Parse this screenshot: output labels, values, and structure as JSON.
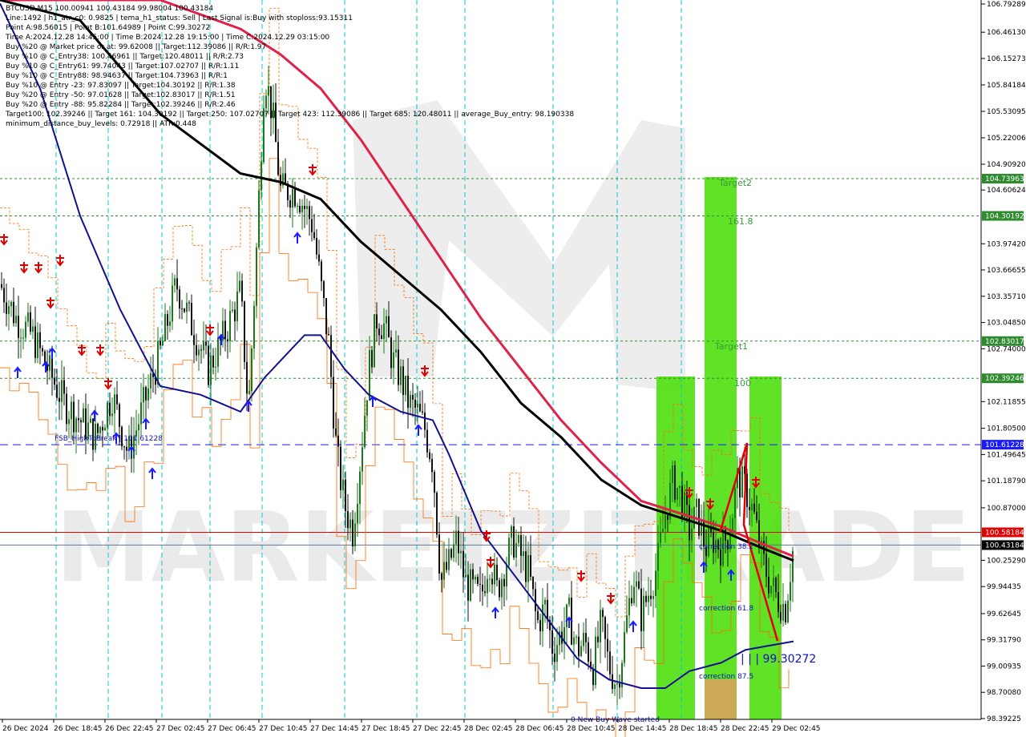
{
  "info_lines": [
    "BTCUSD,M15  100.00941 100.43184 99.98004 100.43184",
    "Line:1492  |  h1_atr_c0: 0.9825  |  tema_h1_status: Sell  |  Last Signal is:Buy with stoploss:93.15311",
    "Point A:98.56015  |  Point B:101.64989  |  Point C:99.30272",
    "Time A:2024.12.28 14:45:00  |  Time B:2024.12.28 19:15:00  |  Time C:2024.12.29 03:15:00",
    "Buy %20 @ Market price or at: 99.62008  ||  Target:112.39086  ||  R/R:1.97",
    "Buy %10 @ C_Entry38: 100.46961  ||  Target:120.48011  ||  R/R:2.73",
    "Buy %10 @ C_Entry61: 99.74043  ||  Target:107.02707  ||  R/R:1.11",
    "Buy %10 @ C_Entry88: 98.94637  ||  Target:104.73963  ||  R/R:1",
    "Buy %10 @ Entry -23: 97.83097  ||  Target:104.30192  ||  R/R:1.38",
    "Buy %20 @ Entry -50: 97.01628  ||  Target:102.83017  ||  R/R:1.51",
    "Buy %20 @ Entry -88: 95.82284  ||  Target:102.39246  ||  R/R:2.46",
    "Target100: 102.39246  ||  Target 161: 104.30192  ||  Target 250: 107.02707  ||  Target 423: 112.39086  ||  Target 685: 120.48011  ||  average_Buy_entry: 98.190338",
    "minimum_distance_buy_levels: 0.72918  ||  ATR:0.448"
  ],
  "annotations": {
    "target2": "Target2",
    "fib161": "161.8",
    "target1": "Target1",
    "fib100": "100",
    "corr38": "correction 38.2",
    "corr61": "correction 61.8",
    "corr87": "correction 87.5",
    "fsb": "FSB_HighToBreak | 101.61228",
    "point_c": "| | | 99.30272",
    "wave": "0 New Buy Wave started",
    "watermark": "MARKETZITRADE"
  },
  "price_tags": [
    {
      "label": "104.73963",
      "bg": "#2e8b2e"
    },
    {
      "label": "104.30192",
      "bg": "#2e8b2e"
    },
    {
      "label": "102.83017",
      "bg": "#2e8b2e"
    },
    {
      "label": "102.39246",
      "bg": "#2e8b2e"
    },
    {
      "label": "101.61228",
      "bg": "#1a1aff"
    },
    {
      "label": "100.58184",
      "bg": "#e00000"
    },
    {
      "label": "100.43184",
      "bg": "#000000"
    }
  ],
  "colors": {
    "sma_black": "#000000",
    "ema_red": "#e0224a",
    "ma_blue": "#101090",
    "up_candle": "#1a7a1a",
    "down_candle": "#111111",
    "green_zone": "#44dd00",
    "target_zone": "#ccaa55",
    "dashed_blue": "#1a1aff",
    "stop_red": "#e00000",
    "vgrid": "#00cccc"
  },
  "chart_data": {
    "type": "candlestick",
    "symbol": "BTCUSD,M15",
    "ylim": [
      98.39225,
      106.79289
    ],
    "y_ticks": [
      "106.79289",
      "106.46130",
      "106.15273",
      "105.84184",
      "105.53095",
      "105.22006",
      "104.90920",
      "104.60624",
      "103.97420",
      "103.66655",
      "103.35710",
      "103.04850",
      "102.74000",
      "102.11855",
      "101.80500",
      "101.49645",
      "101.18790",
      "100.87000",
      "100.25290",
      "99.94435",
      "99.62645",
      "99.31790",
      "99.00935",
      "98.70080",
      "98.39225"
    ],
    "x_ticks": [
      "26 Dec 2024",
      "26 Dec 18:45",
      "26 Dec 22:45",
      "27 Dec 02:45",
      "27 Dec 06:45",
      "27 Dec 10:45",
      "27 Dec 14:45",
      "27 Dec 18:45",
      "27 Dec 22:45",
      "28 Dec 02:45",
      "28 Dec 06:45",
      "28 Dec 10:45",
      "28 Dec 14:45",
      "28 Dec 18:45",
      "28 Dec 22:45",
      "29 Dec 02:45"
    ],
    "close_anchors": [
      [
        0,
        103.5
      ],
      [
        20,
        103.1
      ],
      [
        40,
        102.9
      ],
      [
        60,
        102.5
      ],
      [
        80,
        102.1
      ],
      [
        100,
        101.9
      ],
      [
        120,
        101.7
      ],
      [
        140,
        102.2
      ],
      [
        160,
        101.5
      ],
      [
        180,
        102.1
      ],
      [
        200,
        102.7
      ],
      [
        220,
        103.5
      ],
      [
        240,
        103.0
      ],
      [
        260,
        102.5
      ],
      [
        280,
        102.9
      ],
      [
        300,
        103.4
      ],
      [
        310,
        102.0
      ],
      [
        320,
        103.9
      ],
      [
        330,
        106.0
      ],
      [
        340,
        105.5
      ],
      [
        350,
        104.6
      ],
      [
        370,
        104.6
      ],
      [
        380,
        104.4
      ],
      [
        390,
        104.2
      ],
      [
        400,
        103.5
      ],
      [
        410,
        102.8
      ],
      [
        420,
        101.5
      ],
      [
        430,
        100.9
      ],
      [
        440,
        100.6
      ],
      [
        450,
        101.5
      ],
      [
        460,
        102.5
      ],
      [
        470,
        103.1
      ],
      [
        480,
        103.0
      ],
      [
        490,
        102.6
      ],
      [
        500,
        102.4
      ],
      [
        510,
        102.1
      ],
      [
        520,
        102.0
      ],
      [
        530,
        101.8
      ],
      [
        540,
        101.4
      ],
      [
        550,
        100.0
      ],
      [
        560,
        100.2
      ],
      [
        570,
        100.5
      ],
      [
        580,
        100.0
      ],
      [
        590,
        99.9
      ],
      [
        600,
        99.8
      ],
      [
        610,
        100.3
      ],
      [
        620,
        99.9
      ],
      [
        630,
        100.2
      ],
      [
        640,
        100.5
      ],
      [
        650,
        100.3
      ],
      [
        660,
        100.1
      ],
      [
        670,
        99.5
      ],
      [
        680,
        99.7
      ],
      [
        690,
        99.2
      ],
      [
        700,
        99.4
      ],
      [
        710,
        99.6
      ],
      [
        720,
        99.2
      ],
      [
        730,
        99.3
      ],
      [
        740,
        99.0
      ],
      [
        750,
        99.5
      ],
      [
        760,
        99.0
      ],
      [
        770,
        98.8
      ],
      [
        780,
        99.4
      ],
      [
        790,
        100.1
      ],
      [
        800,
        99.6
      ],
      [
        810,
        99.9
      ],
      [
        820,
        100.2
      ],
      [
        830,
        100.8
      ],
      [
        840,
        101.2
      ],
      [
        850,
        101.0
      ],
      [
        860,
        100.6
      ],
      [
        870,
        100.8
      ],
      [
        880,
        100.4
      ],
      [
        890,
        100.5
      ],
      [
        900,
        100.4
      ],
      [
        910,
        100.6
      ],
      [
        920,
        101.2
      ],
      [
        930,
        101.1
      ],
      [
        940,
        100.8
      ],
      [
        950,
        100.3
      ],
      [
        960,
        100.0
      ],
      [
        970,
        99.8
      ],
      [
        980,
        99.7
      ],
      [
        990,
        100.43
      ]
    ],
    "series": [
      {
        "name": "",
        "type": "sma",
        "points": [
          [
            0,
            107.2
          ],
          [
            100,
            106.6
          ],
          [
            200,
            105.5
          ],
          [
            300,
            104.8
          ],
          [
            350,
            104.7
          ],
          [
            400,
            104.5
          ],
          [
            450,
            104.0
          ],
          [
            500,
            103.6
          ],
          [
            550,
            103.2
          ],
          [
            600,
            102.7
          ],
          [
            650,
            102.1
          ],
          [
            700,
            101.7
          ],
          [
            750,
            101.2
          ],
          [
            800,
            100.9
          ],
          [
            850,
            100.75
          ],
          [
            900,
            100.6
          ],
          [
            950,
            100.4
          ],
          [
            990,
            100.25
          ]
        ]
      },
      {
        "name": "",
        "type": "ema",
        "points": [
          [
            0,
            108.0
          ],
          [
            100,
            107.8
          ],
          [
            200,
            107.5
          ],
          [
            300,
            106.5
          ],
          [
            350,
            106.2
          ],
          [
            400,
            105.8
          ],
          [
            450,
            105.2
          ],
          [
            500,
            104.5
          ],
          [
            550,
            103.8
          ],
          [
            600,
            103.1
          ],
          [
            650,
            102.5
          ],
          [
            700,
            101.9
          ],
          [
            750,
            101.4
          ],
          [
            800,
            100.95
          ],
          [
            850,
            100.8
          ],
          [
            900,
            100.65
          ],
          [
            950,
            100.45
          ],
          [
            990,
            100.3
          ]
        ]
      },
      {
        "name": "",
        "type": "ma",
        "points": [
          [
            0,
            106.8
          ],
          [
            50,
            105.8
          ],
          [
            100,
            104.3
          ],
          [
            150,
            103.2
          ],
          [
            200,
            102.3
          ],
          [
            250,
            102.2
          ],
          [
            300,
            102.0
          ],
          [
            330,
            102.4
          ],
          [
            350,
            102.6
          ],
          [
            380,
            102.9
          ],
          [
            400,
            102.9
          ],
          [
            430,
            102.5
          ],
          [
            460,
            102.2
          ],
          [
            500,
            102.0
          ],
          [
            540,
            101.9
          ],
          [
            560,
            101.5
          ],
          [
            600,
            100.6
          ],
          [
            640,
            100.1
          ],
          [
            680,
            99.6
          ],
          [
            720,
            99.1
          ],
          [
            760,
            98.85
          ],
          [
            800,
            98.75
          ],
          [
            830,
            98.75
          ],
          [
            860,
            98.95
          ],
          [
            900,
            99.05
          ],
          [
            930,
            99.2
          ],
          [
            960,
            99.25
          ],
          [
            990,
            99.3
          ]
        ]
      }
    ],
    "levels": [
      {
        "label": "Target2",
        "value": 104.73963
      },
      {
        "label": "161.8",
        "value": 104.30192
      },
      {
        "label": "Target1",
        "value": 102.83017
      },
      {
        "label": "100",
        "value": 102.39246
      },
      {
        "label": "FSB_HighToBreak",
        "value": 101.61228
      },
      {
        "label": "",
        "value": 100.58184
      },
      {
        "label": "",
        "value": 100.43184
      }
    ],
    "points_abc": {
      "A": 98.56015,
      "B": 101.64989,
      "C": 99.30272
    }
  }
}
